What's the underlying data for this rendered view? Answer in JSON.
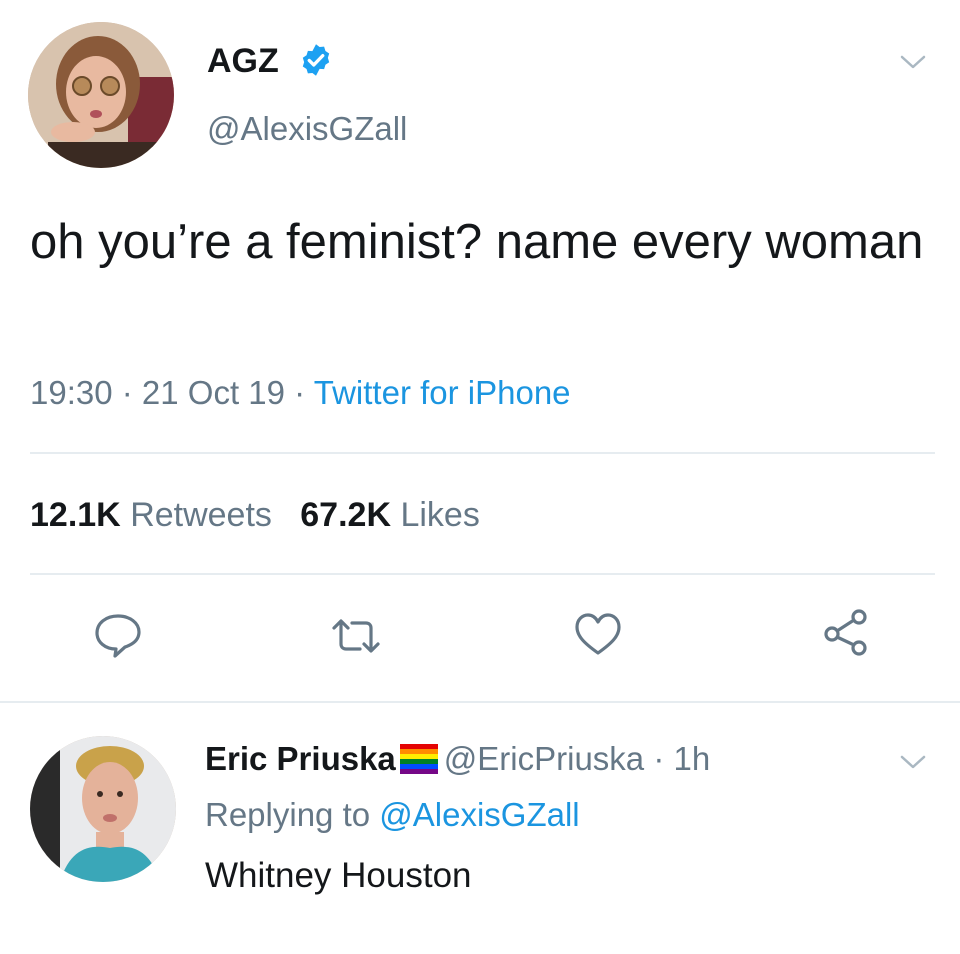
{
  "tweet": {
    "author": {
      "display_name": "AGZ",
      "verified": true,
      "handle": "@AlexisGZall"
    },
    "text": "oh you’re a feminist? name every woman",
    "time": "19:30",
    "date": "21 Oct 19",
    "source": "Twitter for iPhone",
    "separator": " · ",
    "stats": {
      "retweets_count": "12.1K",
      "retweets_label": "Retweets",
      "likes_count": "67.2K",
      "likes_label": "Likes"
    },
    "actions": [
      {
        "name": "reply",
        "icon": "speech-bubble-icon"
      },
      {
        "name": "retweet",
        "icon": "retweet-arrows-icon"
      },
      {
        "name": "like",
        "icon": "heart-icon"
      },
      {
        "name": "share",
        "icon": "share-nodes-icon"
      }
    ]
  },
  "reply": {
    "display_name": "Eric Priuska",
    "flag_icon": "rainbow-flag-icon",
    "handle": "@EricPriuska",
    "separator": " · ",
    "time_ago": "1h",
    "replying_prefix": "Replying to ",
    "replying_handle": "@AlexisGZall",
    "text": "Whitney Houston"
  },
  "colors": {
    "accent": "#1b95e0",
    "secondary_text": "#657786",
    "primary_text": "#14171a",
    "divider": "#e6ecf0"
  }
}
